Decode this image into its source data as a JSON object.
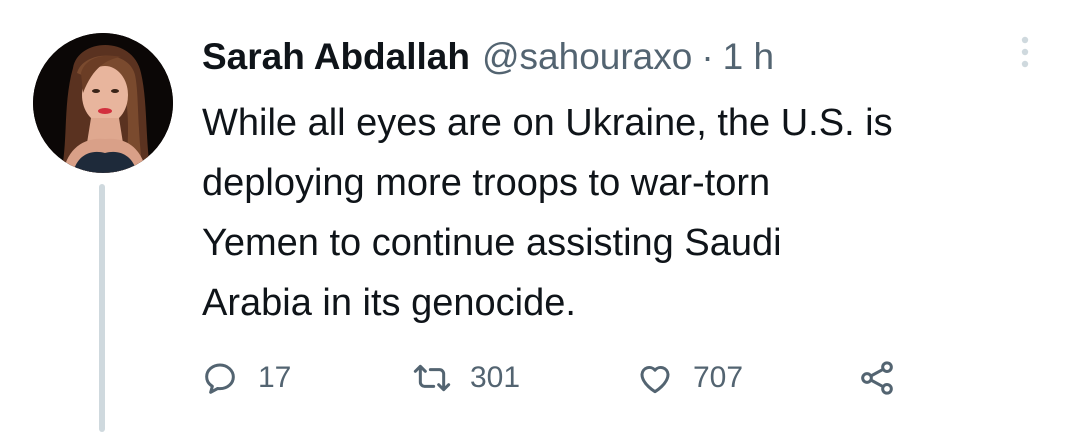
{
  "tweet": {
    "author_name": "Sarah Abdallah",
    "handle": "@sahouraxo",
    "separator": "·",
    "time": "1 h",
    "text_lines": [
      "While all eyes are on Ukraine, the U.S. is",
      "deploying more troops to war-torn",
      "Yemen to continue assisting Saudi",
      "Arabia in its genocide."
    ]
  },
  "actions": {
    "reply_count": "17",
    "retweet_count": "301",
    "like_count": "707"
  },
  "icons": {
    "reply": "reply-icon",
    "retweet": "retweet-icon",
    "like": "heart-icon",
    "share": "share-icon",
    "more": "more-options-icon"
  },
  "colors": {
    "text_primary": "#0f1419",
    "text_secondary": "#536471",
    "thread_line": "#cfd9de"
  }
}
